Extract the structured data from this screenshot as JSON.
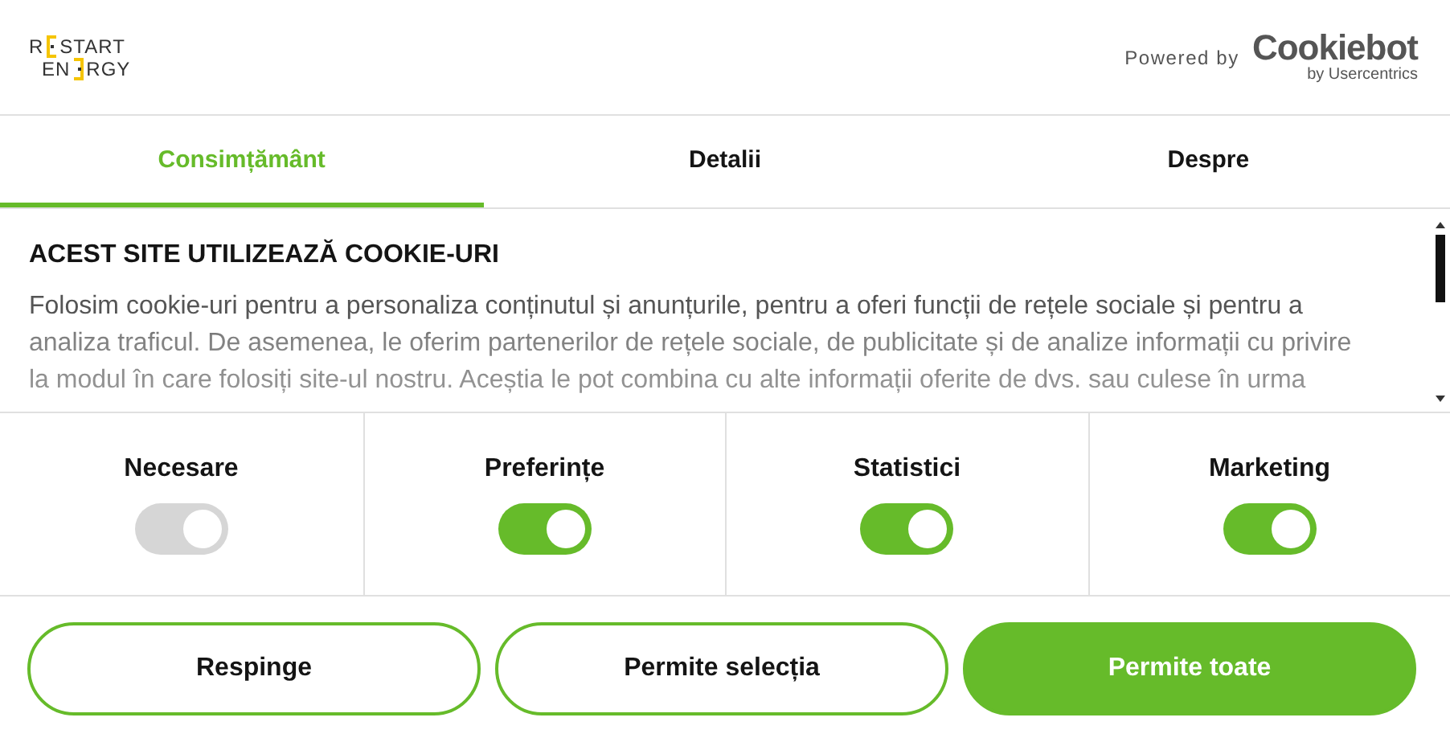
{
  "logo": {
    "line_1": [
      "R",
      "START"
    ],
    "line_2": [
      "EN",
      "RGY"
    ]
  },
  "powered_by": {
    "label": "Powered by",
    "brand": "Cookiebot",
    "brand_sub": "by Usercentrics"
  },
  "tabs": [
    {
      "label": "Consimțământ",
      "selected": true
    },
    {
      "label": "Detalii",
      "selected": false
    },
    {
      "label": "Despre",
      "selected": false
    }
  ],
  "heading": "ACEST SITE UTILIZEAZĂ COOKIE-URI",
  "body": "Folosim cookie-uri pentru a personaliza conținutul și anunțurile, pentru a oferi funcții de rețele sociale și pentru a analiza traficul. De asemenea, le oferim partenerilor de rețele sociale, de publicitate și de analize informații cu privire la modul în care folosiți site-ul nostru. Aceștia le pot combina cu alte informații oferite de dvs. sau culese în urma",
  "categories": [
    {
      "label": "Necesare",
      "on": true,
      "disabled": true
    },
    {
      "label": "Preferințe",
      "on": true,
      "disabled": false
    },
    {
      "label": "Statistici",
      "on": true,
      "disabled": false
    },
    {
      "label": "Marketing",
      "on": true,
      "disabled": false
    }
  ],
  "buttons": [
    {
      "label": "Respinge",
      "kind": "outline"
    },
    {
      "label": "Permite selecția",
      "kind": "outline"
    },
    {
      "label": "Permite toate",
      "kind": "filled"
    }
  ]
}
